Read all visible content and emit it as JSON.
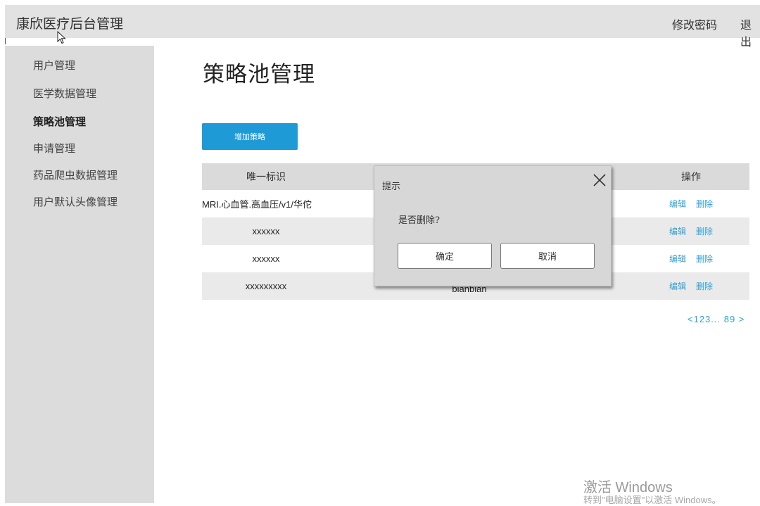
{
  "header": {
    "app_title": "康欣医疗后台管理",
    "change_password": "修改密码",
    "logout": "退出"
  },
  "sidebar": {
    "items": [
      {
        "label": "用户管理"
      },
      {
        "label": "医学数据管理"
      },
      {
        "label": "策略池管理",
        "active": true
      },
      {
        "label": "申请管理"
      },
      {
        "label": "药品爬虫数据管理"
      },
      {
        "label": "用户默认头像管理"
      }
    ]
  },
  "main": {
    "page_title": "策略池管理",
    "add_button": "增加策略",
    "table": {
      "columns": [
        "唯一标识",
        "",
        "操作"
      ],
      "rows": [
        {
          "id": "MRI.心血管.高血压/v1/华佗",
          "name": "",
          "edit": "编辑",
          "delete": "删除"
        },
        {
          "id": "xxxxxx",
          "name": "",
          "edit": "编辑",
          "delete": "删除"
        },
        {
          "id": "xxxxxx",
          "name": "",
          "edit": "编辑",
          "delete": "删除"
        },
        {
          "id": "xxxxxxxxx",
          "name": "bianbian",
          "edit": "编辑",
          "delete": "删除"
        }
      ]
    },
    "pagination": "<123... 89 >"
  },
  "dialog": {
    "title": "提示",
    "message": "是否删除?",
    "confirm": "确定",
    "cancel": "取消"
  },
  "watermark": {
    "line1": "激活 Windows",
    "line2": "转到\"电脑设置\"以激活 Windows。"
  },
  "icons": {
    "close": "close-icon",
    "cursor": "mouse-cursor-icon"
  },
  "colors": {
    "accent": "#1e9ad6",
    "link": "#2fa0d6",
    "topbar": "#e2e2e2",
    "sidebar": "#dcdcdc"
  }
}
